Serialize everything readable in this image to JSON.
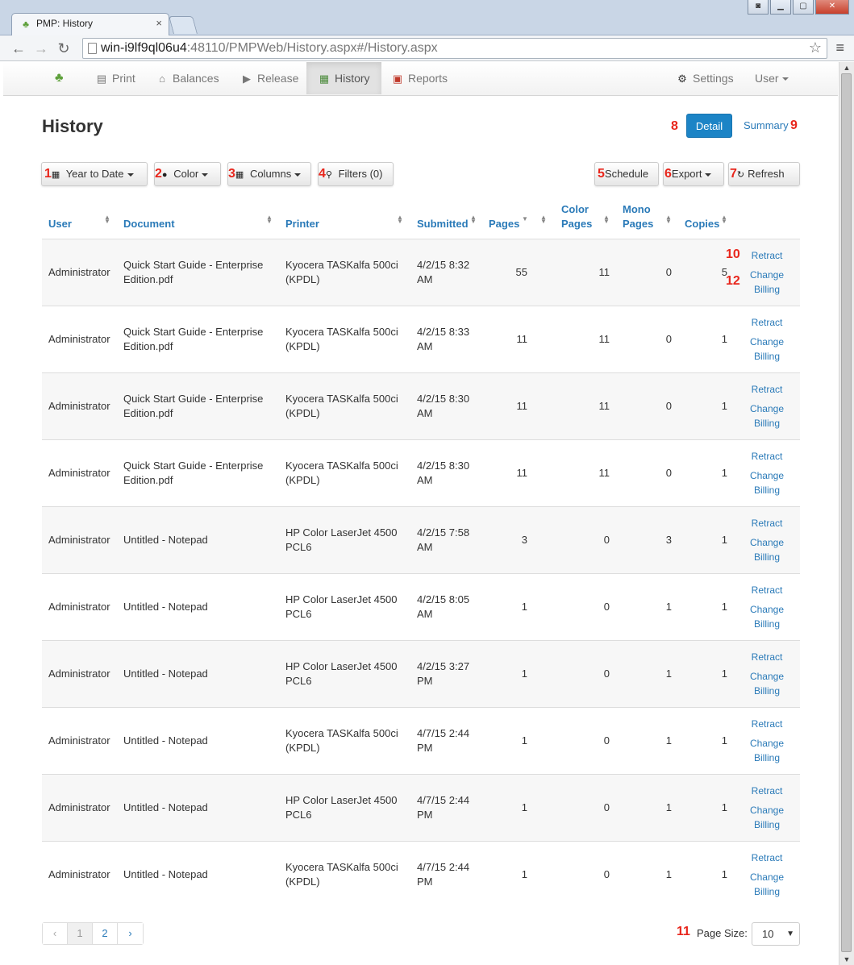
{
  "browser": {
    "tab_title": "PMP: History",
    "tab_close": "×",
    "url_host": "win-i9lf9ql06u4",
    "url_rest": ":48110/PMPWeb/History.aspx#/History.aspx"
  },
  "navbar": {
    "items": [
      {
        "label": "Print",
        "icon": "printer-icon"
      },
      {
        "label": "Balances",
        "icon": "bank-icon"
      },
      {
        "label": "Release",
        "icon": "release-icon"
      },
      {
        "label": "History",
        "icon": "calendar-icon",
        "active": true
      },
      {
        "label": "Reports",
        "icon": "reports-icon"
      }
    ],
    "settings_label": "Settings",
    "user_label": "User"
  },
  "page": {
    "title": "History",
    "detail_label": "Detail",
    "summary_label": "Summary"
  },
  "toolbar": {
    "date_range": "Year to Date",
    "color": "Color",
    "columns": "Columns",
    "filters": "Filters (0)",
    "schedule": "Schedule",
    "export": "Export",
    "refresh": "Refresh"
  },
  "annotations": {
    "n1": "1",
    "n2": "2",
    "n3": "3",
    "n4": "4",
    "n5": "5",
    "n6": "6",
    "n7": "7",
    "n8": "8",
    "n9": "9",
    "n10": "10",
    "n11": "11",
    "n12": "12"
  },
  "table": {
    "headers": {
      "user": "User",
      "document": "Document",
      "printer": "Printer",
      "submitted": "Submitted",
      "pages": "Pages",
      "color_pages_1": "Color",
      "color_pages_2": "Pages",
      "mono_pages_1": "Mono",
      "mono_pages_2": "Pages",
      "copies": "Copies"
    },
    "actions": {
      "retract": "Retract",
      "change1": "Change",
      "change2": "Billing"
    },
    "rows": [
      {
        "user": "Administrator",
        "doc1": "Quick Start Guide - Enterprise",
        "doc2": "Edition.pdf",
        "pr1": "Kyocera TASKalfa 500ci",
        "pr2": "(KPDL)",
        "sub1": "4/2/15 8:32",
        "sub2": "AM",
        "pages": "55",
        "color": "11",
        "mono": "0",
        "copies": "5"
      },
      {
        "user": "Administrator",
        "doc1": "Quick Start Guide - Enterprise",
        "doc2": "Edition.pdf",
        "pr1": "Kyocera TASKalfa 500ci",
        "pr2": "(KPDL)",
        "sub1": "4/2/15 8:33",
        "sub2": "AM",
        "pages": "11",
        "color": "11",
        "mono": "0",
        "copies": "1"
      },
      {
        "user": "Administrator",
        "doc1": "Quick Start Guide - Enterprise",
        "doc2": "Edition.pdf",
        "pr1": "Kyocera TASKalfa 500ci",
        "pr2": "(KPDL)",
        "sub1": "4/2/15 8:30",
        "sub2": "AM",
        "pages": "11",
        "color": "11",
        "mono": "0",
        "copies": "1"
      },
      {
        "user": "Administrator",
        "doc1": "Quick Start Guide - Enterprise",
        "doc2": "Edition.pdf",
        "pr1": "Kyocera TASKalfa 500ci",
        "pr2": "(KPDL)",
        "sub1": "4/2/15 8:30",
        "sub2": "AM",
        "pages": "11",
        "color": "11",
        "mono": "0",
        "copies": "1"
      },
      {
        "user": "Administrator",
        "doc1": "Untitled - Notepad",
        "doc2": "",
        "pr1": "HP Color LaserJet 4500",
        "pr2": "PCL6",
        "sub1": "4/2/15 7:58",
        "sub2": "AM",
        "pages": "3",
        "color": "0",
        "mono": "3",
        "copies": "1"
      },
      {
        "user": "Administrator",
        "doc1": "Untitled - Notepad",
        "doc2": "",
        "pr1": "HP Color LaserJet 4500",
        "pr2": "PCL6",
        "sub1": "4/2/15 8:05",
        "sub2": "AM",
        "pages": "1",
        "color": "0",
        "mono": "1",
        "copies": "1"
      },
      {
        "user": "Administrator",
        "doc1": "Untitled - Notepad",
        "doc2": "",
        "pr1": "HP Color LaserJet 4500",
        "pr2": "PCL6",
        "sub1": "4/2/15 3:27",
        "sub2": "PM",
        "pages": "1",
        "color": "0",
        "mono": "1",
        "copies": "1"
      },
      {
        "user": "Administrator",
        "doc1": "Untitled - Notepad",
        "doc2": "",
        "pr1": "Kyocera TASKalfa 500ci",
        "pr2": "(KPDL)",
        "sub1": "4/7/15 2:44",
        "sub2": "PM",
        "pages": "1",
        "color": "0",
        "mono": "1",
        "copies": "1"
      },
      {
        "user": "Administrator",
        "doc1": "Untitled - Notepad",
        "doc2": "",
        "pr1": "HP Color LaserJet 4500",
        "pr2": "PCL6",
        "sub1": "4/7/15 2:44",
        "sub2": "PM",
        "pages": "1",
        "color": "0",
        "mono": "1",
        "copies": "1"
      },
      {
        "user": "Administrator",
        "doc1": "Untitled - Notepad",
        "doc2": "",
        "pr1": "Kyocera TASKalfa 500ci",
        "pr2": "(KPDL)",
        "sub1": "4/7/15 2:44",
        "sub2": "PM",
        "pages": "1",
        "color": "0",
        "mono": "1",
        "copies": "1"
      }
    ]
  },
  "pagination": {
    "prev": "‹",
    "pages": [
      "1",
      "2"
    ],
    "next": "›",
    "current": "1"
  },
  "page_size": {
    "label": "Page Size:",
    "value": "10"
  },
  "colors": {
    "primary": "#1c84c6",
    "link": "#2a7ab8",
    "annotation": "#e8261c"
  }
}
